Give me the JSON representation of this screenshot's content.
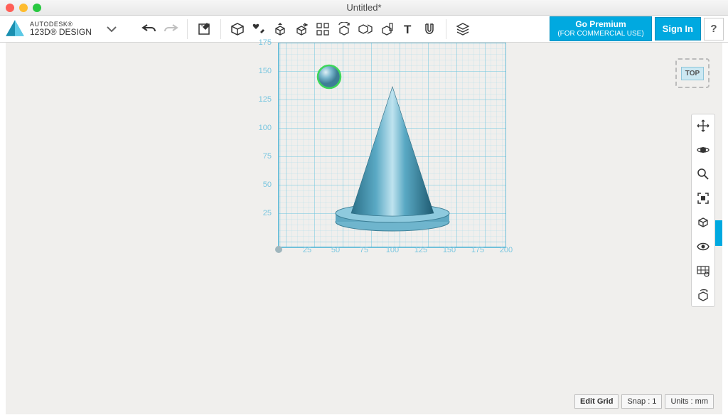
{
  "titlebar": {
    "title": "Untitled*"
  },
  "brand": {
    "line1": "AUTODESK®",
    "line2": "123D® DESIGN"
  },
  "buttons": {
    "goPremium": {
      "line1": "Go Premium",
      "line2": "(FOR COMMERCIAL USE)"
    },
    "signIn": "Sign In",
    "help": "?"
  },
  "viewcube": {
    "face": "TOP"
  },
  "grid": {
    "y_ticks": [
      "175",
      "150",
      "125",
      "100",
      "75",
      "50",
      "25"
    ],
    "x_ticks": [
      "25",
      "50",
      "75",
      "100",
      "125",
      "150",
      "175",
      "200"
    ]
  },
  "status": {
    "editGrid": "Edit Grid",
    "snap": "Snap : 1",
    "units": "Units : mm"
  },
  "toolbar_icons": [
    "undo",
    "redo",
    "edit-page",
    "primitive",
    "sketch",
    "construct",
    "modify",
    "pattern",
    "grouping",
    "combine",
    "measure",
    "text",
    "snap",
    "materials"
  ],
  "side_icons": [
    "pan",
    "orbit",
    "zoom",
    "fit",
    "show-hide",
    "visibility",
    "display",
    "regen"
  ]
}
